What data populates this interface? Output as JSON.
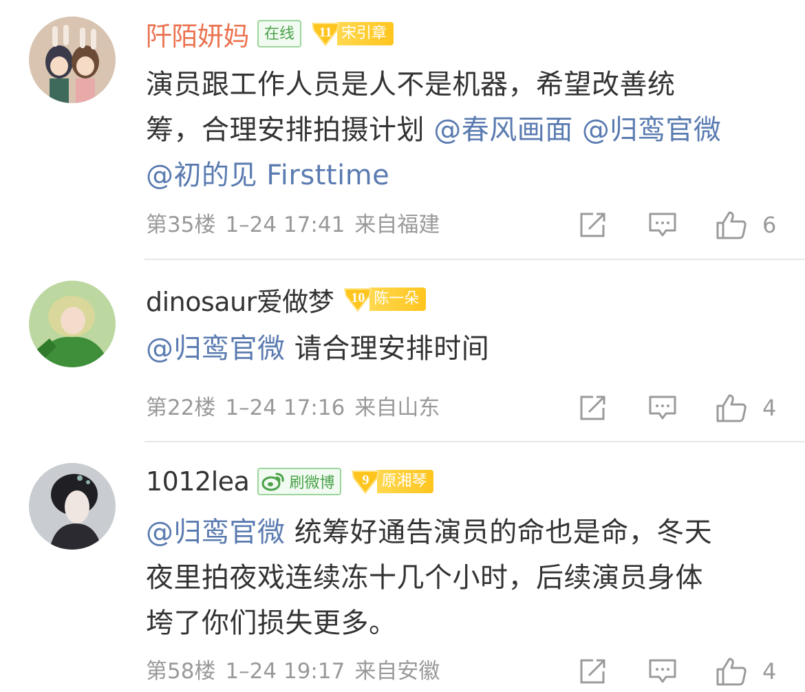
{
  "comments": [
    {
      "username": "阡陌妍妈",
      "online_badge": "在线",
      "fan_badge": {
        "level": "11",
        "name": "宋引章"
      },
      "text_line1": "演员跟工作人员是人不是机器，希望改善统",
      "text_line2_plain": "筹，合理安排拍摄计划 ",
      "mention_a": "@春风画面",
      "mention_b": " @归鸾官微",
      "mention_c": "@初的见 Firsttime",
      "floor": "第35楼",
      "time": "1–24 17:41",
      "location": "来自福建",
      "like_count": "6"
    },
    {
      "username": "dinosaur爱做梦",
      "fan_badge": {
        "level": "10",
        "name": "陈一朵"
      },
      "mention": "@归鸾官微",
      "text": " 请合理安排时间",
      "floor": "第22楼",
      "time": "1–24 17:16",
      "location": "来自山东",
      "like_count": "4"
    },
    {
      "username": "1012lea",
      "weibo_badge": "刷微博",
      "fan_badge": {
        "level": "9",
        "name": "原湘琴"
      },
      "mention": "@归鸾官微",
      "text_line1": " 统筹好通告演员的命也是命，冬天",
      "text_line2": "夜里拍夜戏连续冻十几个小时，后续演员身体",
      "text_line3": "垮了你们损失更多。",
      "floor": "第58楼",
      "time": "1–24 19:17",
      "location": "来自安徽",
      "like_count": "4"
    }
  ],
  "icons": {
    "repost": "share-icon",
    "comment": "comment-icon",
    "like": "thumbs-up-icon",
    "weibo": "weibo-logo-icon"
  },
  "colors": {
    "username_vip": "#eb7350",
    "mention": "#5a7bb0",
    "meta": "#999999",
    "text": "#333333"
  }
}
